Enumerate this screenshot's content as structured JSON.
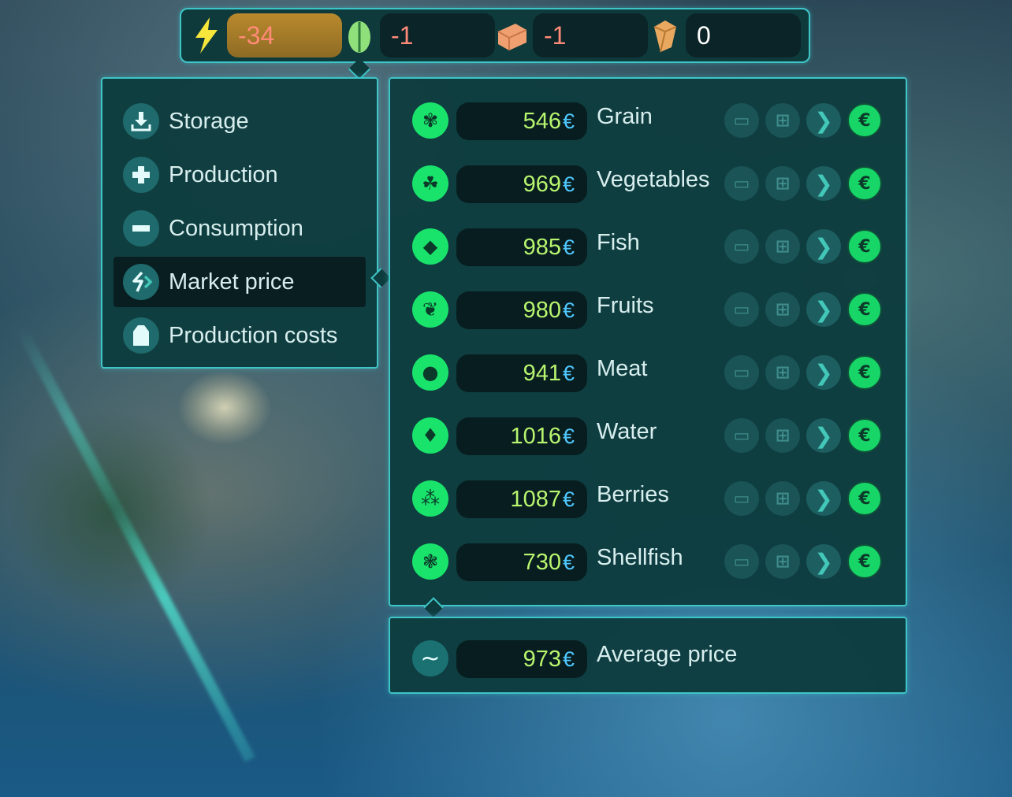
{
  "topbar": {
    "resources": [
      {
        "icon": "lightning-icon",
        "value": "-34",
        "color": "#f6e53b"
      },
      {
        "icon": "leaf-icon",
        "value": "-1",
        "color": "#8fe07a"
      },
      {
        "icon": "brick-icon",
        "value": "-1",
        "color": "#f0a070"
      },
      {
        "icon": "crystal-icon",
        "value": "0",
        "color": "#e8a860"
      }
    ]
  },
  "menu": {
    "items": [
      {
        "label": "Storage",
        "icon": "storage-icon"
      },
      {
        "label": "Production",
        "icon": "plus-icon"
      },
      {
        "label": "Consumption",
        "icon": "minus-icon"
      },
      {
        "label": "Market price",
        "icon": "market-icon",
        "active": true
      },
      {
        "label": "Production costs",
        "icon": "tag-icon"
      }
    ]
  },
  "goods": {
    "currency": "€",
    "items": [
      {
        "name": "Grain",
        "price": "546",
        "icon": "grain-icon"
      },
      {
        "name": "Vegetables",
        "price": "969",
        "icon": "vegetables-icon"
      },
      {
        "name": "Fish",
        "price": "985",
        "icon": "fish-icon"
      },
      {
        "name": "Fruits",
        "price": "980",
        "icon": "fruits-icon"
      },
      {
        "name": "Meat",
        "price": "941",
        "icon": "meat-icon"
      },
      {
        "name": "Water",
        "price": "1016",
        "icon": "water-icon"
      },
      {
        "name": "Berries",
        "price": "1087",
        "icon": "berries-icon"
      },
      {
        "name": "Shellfish",
        "price": "730",
        "icon": "shellfish-icon"
      }
    ]
  },
  "average": {
    "label": "Average price",
    "price": "973",
    "icon": "tilde-icon"
  },
  "colors": {
    "accent": "#3ec5c7",
    "good_icon": "#19e36b",
    "price_text": "#b8f56f",
    "currency": "#4fc8ff"
  }
}
